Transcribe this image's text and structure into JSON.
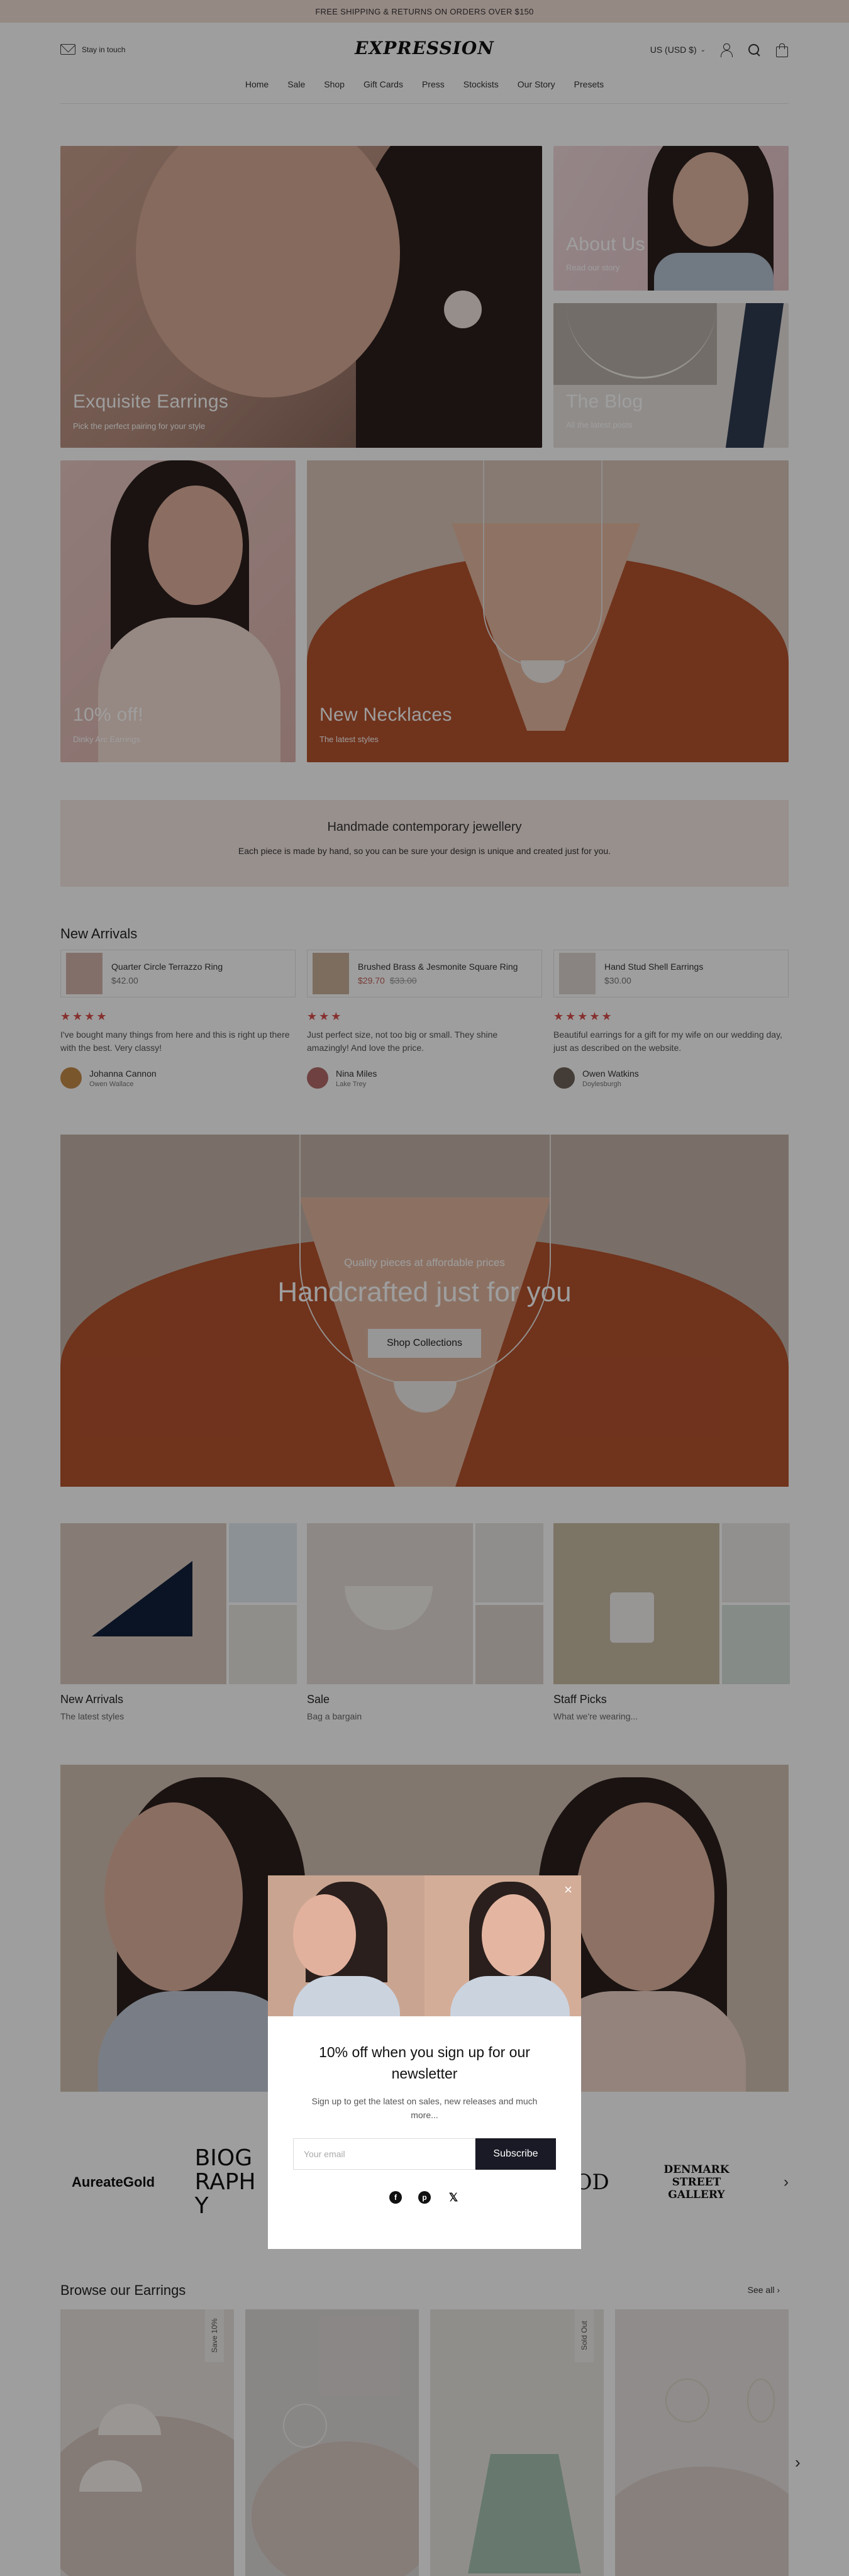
{
  "announcement": "FREE SHIPPING & RETURNS ON ORDERS OVER $150",
  "header": {
    "stay_in_touch": "Stay in touch",
    "logo": "EXPRESSION",
    "currency": "US (USD $)",
    "nav": [
      "Home",
      "Sale",
      "Shop",
      "Gift Cards",
      "Press",
      "Stockists",
      "Our Story",
      "Presets"
    ]
  },
  "tiles": {
    "earrings": {
      "title": "Exquisite Earrings",
      "sub": "Pick the perfect pairing for your style"
    },
    "about": {
      "title": "About Us",
      "sub": "Read our story"
    },
    "blog": {
      "title": "The Blog",
      "sub": "All the latest posts"
    },
    "off": {
      "title": "10% off!",
      "sub": "Dinky Arc Earrings"
    },
    "necklaces": {
      "title": "New Necklaces",
      "sub": "The latest styles"
    }
  },
  "promo": {
    "title": "Handmade contemporary jewellery",
    "text": "Each piece is made by hand, so you can be sure your design is unique and created just for you."
  },
  "new_arrivals": {
    "title": "New Arrivals",
    "reviews": [
      {
        "product": "Quarter Circle Terrazzo Ring",
        "price": "$42.00",
        "sale_price": "",
        "old_price": "",
        "stars": "★★★★",
        "text": "I've bought many things from here and this is right up there with the best. Very classy!",
        "author": "Johanna Cannon",
        "location": "Owen Wallace"
      },
      {
        "product": "Brushed Brass & Jesmonite Square Ring",
        "price": "",
        "sale_price": "$29.70",
        "old_price": "$33.00",
        "stars": "★★★",
        "text": "Just perfect size, not too big or small. They shine amazingly! And love the price.",
        "author": "Nina Miles",
        "location": "Lake Trey"
      },
      {
        "product": "Hand Stud Shell Earrings",
        "price": "$30.00",
        "sale_price": "",
        "old_price": "",
        "stars": "★★★★★",
        "text": "Beautiful earrings for a gift for my wife on our wedding day, just as described on the website.",
        "author": "Owen Watkins",
        "location": "Doylesburgh"
      }
    ]
  },
  "hero": {
    "eyebrow": "Quality pieces at affordable prices",
    "title": "Handcrafted just for you",
    "button": "Shop Collections"
  },
  "collections": [
    {
      "name": "New Arrivals",
      "sub": "The latest styles"
    },
    {
      "name": "Sale",
      "sub": "Bag a bargain"
    },
    {
      "name": "Staff Picks",
      "sub": "What we're wearing..."
    }
  ],
  "logos": [
    "AureateGold",
    "BIOGRAPHY",
    "REDWOOD",
    "DENMARK STREET GALLERY"
  ],
  "browse": {
    "title": "Browse our Earrings",
    "see_all": "See all",
    "badges": [
      "Save 10%",
      "Sold Out"
    ]
  },
  "modal": {
    "title": "10% off when you sign up for our newsletter",
    "text": "Sign up to get the latest on sales, new releases and much more...",
    "placeholder": "Your email",
    "button": "Subscribe",
    "close": "×"
  },
  "colors": {
    "announce_bg": "#f1ddd6",
    "accent_red": "#d8504c",
    "subscribe_bg": "#1a1a26",
    "promo_bg": "#f5e8e4"
  }
}
